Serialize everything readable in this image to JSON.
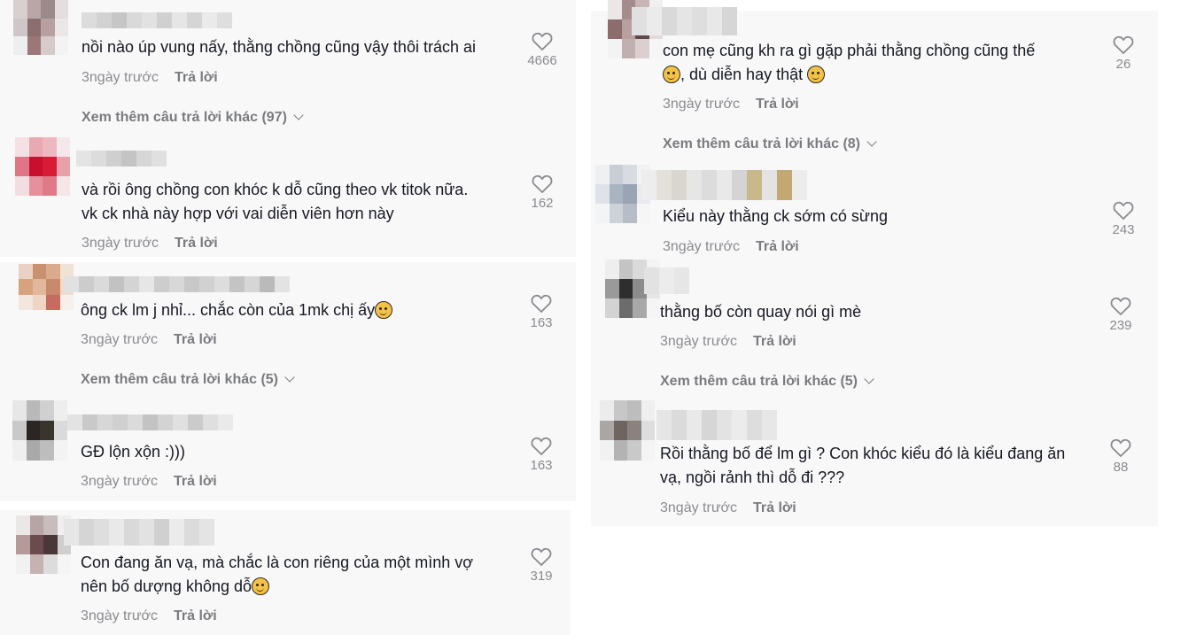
{
  "left": {
    "comments": [
      {
        "text": "nồi nào úp vung nấy, thằng chồng cũng vậy thôi trách ai",
        "time": "3ngày trước",
        "reply": "Trả lời",
        "likes": "4666",
        "more": "Xem thêm câu trả lời khác (97)"
      },
      {
        "text": "và rồi ông chồng con khóc k dỗ cũng theo vk titok nữa.",
        "text2": "vk ck nhà này hợp với vai diễn viên hơn này",
        "time": "3ngày trước",
        "reply": "Trả lời",
        "likes": "162"
      },
      {
        "text": "ông ck lm j nhỉ... chắc còn của 1mk chị ấy",
        "time": "3ngày trước",
        "reply": "Trả lời",
        "likes": "163",
        "more": "Xem thêm câu trả lời khác (5)"
      },
      {
        "text": "GĐ lộn xộn :)))",
        "time": "3ngày trước",
        "reply": "Trả lời",
        "likes": "163"
      },
      {
        "text": "Con đang ăn vạ, mà chắc là con riêng của một mình vợ",
        "text2": "nên bố dượng không dỗ",
        "time": "3ngày trước",
        "reply": "Trả lời",
        "likes": "319"
      }
    ]
  },
  "right": {
    "comments": [
      {
        "text": "con mẹ cũng kh ra gì gặp phải thằng chồng cũng thế",
        "text2": ", dù diễn hay thật",
        "time": "3ngày trước",
        "reply": "Trả lời",
        "likes": "26",
        "more": "Xem thêm câu trả lời khác (8)"
      },
      {
        "text": "Kiểu này thằng ck sớm có sừng",
        "time": "3ngày trước",
        "reply": "Trả lời",
        "likes": "243"
      },
      {
        "text": "thằng bố còn quay nói gì mè",
        "time": "3ngày trước",
        "reply": "Trả lời",
        "likes": "239",
        "more": "Xem thêm câu trả lời khác (5)"
      },
      {
        "text": "Rồi thằng bố để lm gì ? Con khóc kiểu đó là kiểu đang ăn",
        "text2": "vạ, ngồi rảnh thì dỗ đi ???",
        "time": "3ngày trước",
        "reply": "Trả lời",
        "likes": "88"
      }
    ]
  },
  "icons": {
    "like": "heart-outline-icon",
    "emoji_smirk": "smirking-face-icon",
    "emoji_pensive": "pensive-face-icon",
    "emoji_laugh": "laughing-face-icon",
    "chevron": "chevron-down-icon"
  },
  "colors": {
    "background": "#f8f8f8",
    "text": "#161823",
    "muted": "#8a8b91"
  }
}
